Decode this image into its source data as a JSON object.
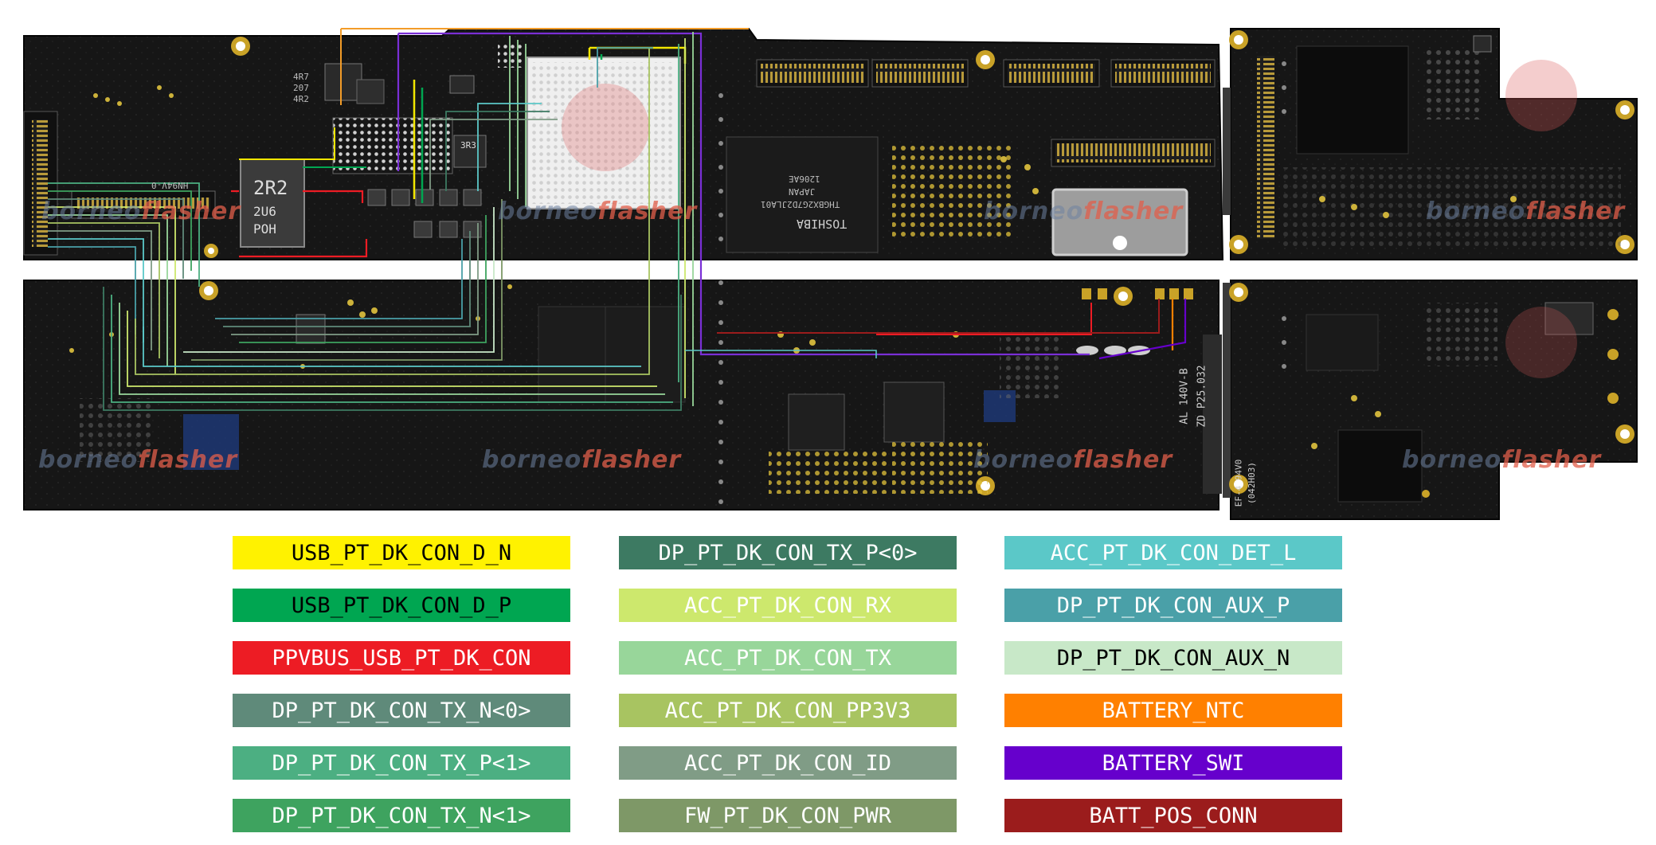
{
  "board": {
    "watermark_parts": [
      "borneo",
      "flasher"
    ],
    "labels": {
      "ind1": "4R7",
      "ind2": "207",
      "ind3": "4R2",
      "big_inductor_1": "2R2",
      "big_inductor_2": "2U6",
      "big_inductor_3": "POH",
      "small_ind": "3R3",
      "chip_code": "HN94V-0",
      "toshiba": "TOSHIBA",
      "toshiba_code1": "THGBX2G7D2JLA01",
      "toshiba_code2": "JAPAN",
      "toshiba_code3": "1206AE",
      "flex_code1": "AL 140V-B",
      "flex_code2": "ZD P25.032",
      "flex_code3": "EF-4 94V0",
      "flex_code4": "(042H03)"
    }
  },
  "legend": {
    "items": [
      {
        "id": "usb-d-n",
        "label": "USB_PT_DK_CON_D_N",
        "bg": "#fff200",
        "fg": "#000000"
      },
      {
        "id": "usb-d-p",
        "label": "USB_PT_DK_CON_D_P",
        "bg": "#00a651",
        "fg": "#000000"
      },
      {
        "id": "ppvbus",
        "label": "PPVBUS_USB_PT_DK_CON",
        "bg": "#ed1c24",
        "fg": "#ffffff"
      },
      {
        "id": "dp-tx-n0",
        "label": "DP_PT_DK_CON_TX_N<0>",
        "bg": "#5f8a7a",
        "fg": "#ffffff"
      },
      {
        "id": "dp-tx-p1",
        "label": "DP_PT_DK_CON_TX_P<1>",
        "bg": "#4caf82",
        "fg": "#ffffff"
      },
      {
        "id": "dp-tx-n1",
        "label": "DP_PT_DK_CON_TX_N<1>",
        "bg": "#3ea35f",
        "fg": "#ffffff"
      },
      {
        "id": "dp-tx-p0",
        "label": "DP_PT_DK_CON_TX_P<0>",
        "bg": "#3d7a62",
        "fg": "#ffffff"
      },
      {
        "id": "acc-rx",
        "label": "ACC_PT_DK_CON_RX",
        "bg": "#cde86d",
        "fg": "#ffffff"
      },
      {
        "id": "acc-tx",
        "label": "ACC_PT_DK_CON_TX",
        "bg": "#98d69a",
        "fg": "#ffffff"
      },
      {
        "id": "acc-pp3v3",
        "label": "ACC_PT_DK_CON_PP3V3",
        "bg": "#a8c461",
        "fg": "#ffffff"
      },
      {
        "id": "acc-id",
        "label": "ACC_PT_DK_CON_ID",
        "bg": "#809c86",
        "fg": "#ffffff"
      },
      {
        "id": "fw-pwr",
        "label": "FW_PT_DK_CON_PWR",
        "bg": "#7e9867",
        "fg": "#ffffff"
      },
      {
        "id": "acc-det-l",
        "label": "ACC_PT_DK_CON_DET_L",
        "bg": "#5bc8c8",
        "fg": "#ffffff"
      },
      {
        "id": "dp-aux-p",
        "label": "DP_PT_DK_CON_AUX_P",
        "bg": "#4aa0a8",
        "fg": "#ffffff"
      },
      {
        "id": "dp-aux-n",
        "label": "DP_PT_DK_CON_AUX_N",
        "bg": "#c8e8c8",
        "fg": "#000000"
      },
      {
        "id": "batt-ntc",
        "label": "BATTERY_NTC",
        "bg": "#ff8000",
        "fg": "#ffffff"
      },
      {
        "id": "batt-swi",
        "label": "BATTERY_SWI",
        "bg": "#6600cc",
        "fg": "#ffffff"
      },
      {
        "id": "batt-pos",
        "label": "BATT_POS_CONN",
        "bg": "#9b1c1c",
        "fg": "#ffffff"
      }
    ]
  }
}
